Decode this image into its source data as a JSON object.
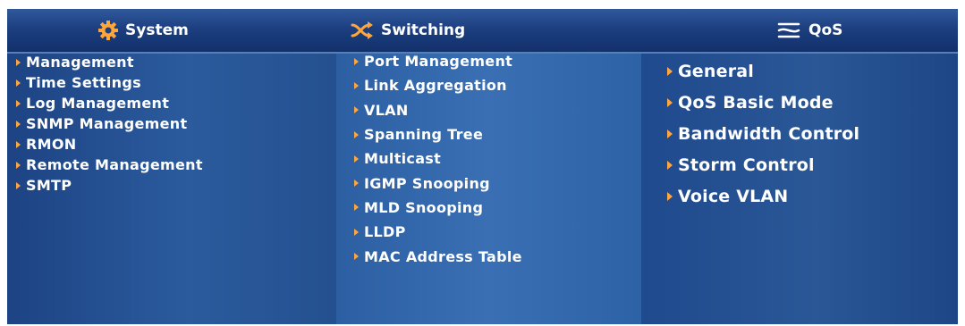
{
  "header": {
    "system": {
      "label": "System",
      "icon": "gear-icon"
    },
    "switching": {
      "label": "Switching",
      "icon": "switch-arrows-icon"
    },
    "qos": {
      "label": "QoS",
      "icon": "qos-lines-icon"
    }
  },
  "menus": {
    "system": [
      "Management",
      "Time Settings",
      "Log Management",
      "SNMP Management",
      "RMON",
      "Remote Management",
      "SMTP"
    ],
    "switching": [
      "Port Management",
      "Link Aggregation",
      "VLAN",
      "Spanning Tree",
      "Multicast",
      "IGMP Snooping",
      "MLD Snooping",
      "LLDP",
      "MAC Address Table"
    ],
    "qos": [
      "General",
      "QoS Basic Mode",
      "Bandwidth Control",
      "Storm Control",
      "Voice VLAN"
    ]
  },
  "colors": {
    "bullet": "#ffa640",
    "header_bg": "#1c3f80",
    "text": "#ffffff"
  }
}
